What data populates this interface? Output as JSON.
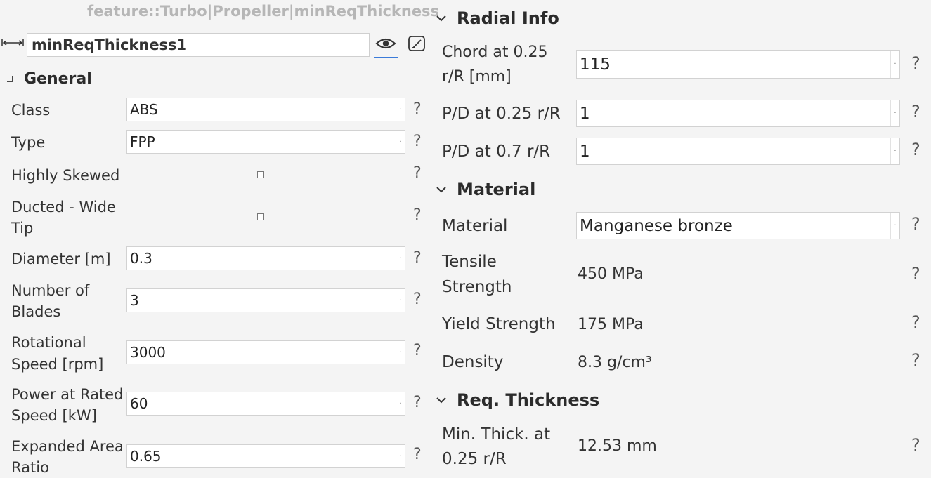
{
  "breadcrumb": "feature::Turbo|Propeller|minReqThickness",
  "name_field": {
    "value": "minReqThickness1"
  },
  "help_glyph": "?",
  "general": {
    "title": "General",
    "class": {
      "label": "Class",
      "value": "ABS"
    },
    "type": {
      "label": "Type",
      "value": "FPP"
    },
    "highly_skewed": {
      "label": "Highly Skewed",
      "checked": false
    },
    "ducted": {
      "label_line1": "Ducted - Wide",
      "label_line2": "Tip",
      "checked": false
    },
    "diameter": {
      "label": "Diameter [m]",
      "value": "0.3"
    },
    "blades": {
      "label_line1": "Number of",
      "label_line2": "Blades",
      "value": "3"
    },
    "speed": {
      "label_line1": "Rotational",
      "label_line2": "Speed [rpm]",
      "value": "3000"
    },
    "power": {
      "label_line1": "Power at Rated",
      "label_line2": "Speed [kW]",
      "value": "60"
    },
    "area_ratio": {
      "label_line1": "Expanded Area",
      "label_line2": "Ratio",
      "value": "0.65"
    }
  },
  "radial": {
    "title": "Radial Info",
    "chord": {
      "label_line1": "Chord at 0.25",
      "label_line2": "r/R [mm]",
      "value": "115"
    },
    "pd025": {
      "label": "P/D at 0.25 r/R",
      "value": "1"
    },
    "pd07": {
      "label": "P/D at 0.7 r/R",
      "value": "1"
    }
  },
  "material": {
    "title": "Material",
    "material": {
      "label": "Material",
      "value": "Manganese bronze"
    },
    "tensile": {
      "label_line1": "Tensile",
      "label_line2": "Strength",
      "value": "450 MPa"
    },
    "yield": {
      "label": "Yield Strength",
      "value": "175 MPa"
    },
    "density": {
      "label": "Density",
      "value": "8.3 g/cm³"
    }
  },
  "thickness": {
    "title": "Req. Thickness",
    "min_thick": {
      "label_line1": "Min. Thick. at",
      "label_line2": "0.25 r/R",
      "value": "12.53 mm"
    }
  },
  "colors": {
    "accent": "#3b7bd9",
    "breadcrumb": "#b6b6b6",
    "background": "#f4f4f4"
  }
}
